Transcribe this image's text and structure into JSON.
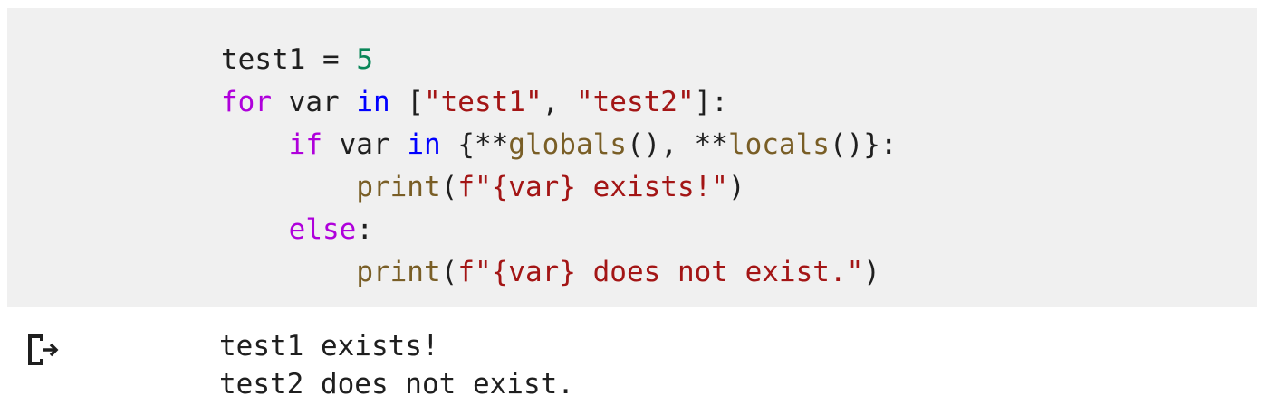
{
  "code_cell": {
    "lines": [
      {
        "tokens": [
          {
            "text": "test1",
            "kind": "id"
          },
          {
            "text": " = ",
            "kind": "op"
          },
          {
            "text": "5",
            "kind": "num"
          }
        ]
      },
      {
        "tokens": [
          {
            "text": "for",
            "kind": "kw-purple"
          },
          {
            "text": " var ",
            "kind": "id"
          },
          {
            "text": "in",
            "kind": "kw-blue"
          },
          {
            "text": " [",
            "kind": "op"
          },
          {
            "text": "\"test1\"",
            "kind": "str"
          },
          {
            "text": ", ",
            "kind": "op"
          },
          {
            "text": "\"test2\"",
            "kind": "str"
          },
          {
            "text": "]:",
            "kind": "op"
          }
        ]
      },
      {
        "indent": "    ",
        "tokens": [
          {
            "text": "if",
            "kind": "kw-purple"
          },
          {
            "text": " var ",
            "kind": "id"
          },
          {
            "text": "in",
            "kind": "kw-blue"
          },
          {
            "text": " {**",
            "kind": "op"
          },
          {
            "text": "globals",
            "kind": "func"
          },
          {
            "text": "(), **",
            "kind": "op"
          },
          {
            "text": "locals",
            "kind": "func"
          },
          {
            "text": "()}:",
            "kind": "op"
          }
        ]
      },
      {
        "indent": "        ",
        "tokens": [
          {
            "text": "print",
            "kind": "func"
          },
          {
            "text": "(",
            "kind": "op"
          },
          {
            "text": "f\"{var} exists!\"",
            "kind": "str"
          },
          {
            "text": ")",
            "kind": "op"
          }
        ]
      },
      {
        "indent": "    ",
        "tokens": [
          {
            "text": "else",
            "kind": "kw-purple"
          },
          {
            "text": ":",
            "kind": "op"
          }
        ]
      },
      {
        "indent": "        ",
        "tokens": [
          {
            "text": "print",
            "kind": "func"
          },
          {
            "text": "(",
            "kind": "op"
          },
          {
            "text": "f\"{var} does not exist.\"",
            "kind": "str"
          },
          {
            "text": ")",
            "kind": "op"
          }
        ]
      }
    ]
  },
  "output": {
    "icon": "output-redirect-icon",
    "lines": [
      "test1 exists!",
      "test2 does not exist."
    ]
  },
  "colors": {
    "cell_background": "#f0f0f0",
    "keyword_control": "#af00db",
    "keyword_operator": "#0000ff",
    "number": "#098658",
    "string": "#a31515",
    "function": "#795e26",
    "text": "#1f1f1f"
  }
}
